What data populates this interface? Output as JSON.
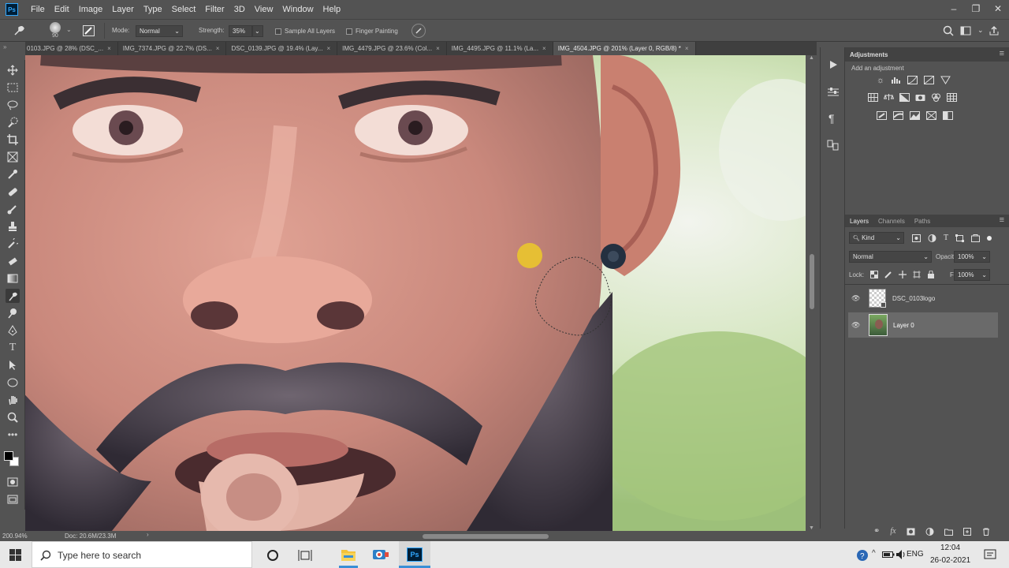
{
  "app": {
    "logo_text": "Ps"
  },
  "menu": [
    "File",
    "Edit",
    "Image",
    "Layer",
    "Type",
    "Select",
    "Filter",
    "3D",
    "View",
    "Window",
    "Help"
  ],
  "options": {
    "brush_size": "90",
    "mode_label": "Mode:",
    "mode_value": "Normal",
    "strength_label": "Strength:",
    "strength_value": "35%",
    "sample_all_layers": "Sample All Layers",
    "finger_painting": "Finger Painting"
  },
  "tabs": [
    {
      "label": "0103.JPG @ 28% (DSC_...",
      "active": false
    },
    {
      "label": "IMG_7374.JPG @ 22.7% (DS...",
      "active": false
    },
    {
      "label": "DSC_0139.JPG @ 19.4% (Lay...",
      "active": false
    },
    {
      "label": "IMG_4479.JPG @ 23.6% (Col...",
      "active": false
    },
    {
      "label": "IMG_4495.JPG @ 11.1% (La...",
      "active": false
    },
    {
      "label": "IMG_4504.JPG @ 201% (Layer 0, RGB/8) *",
      "active": true
    }
  ],
  "status": {
    "zoom": "200.94%",
    "doc": "Doc: 20.6M/23.3M"
  },
  "adjustments": {
    "title": "Adjustments",
    "subtitle": "Add an adjustment"
  },
  "layers_panel": {
    "tabs": [
      "Layers",
      "Channels",
      "Paths"
    ],
    "filter_kind": "Kind",
    "blend_mode": "Normal",
    "opacity_label": "Opacity:",
    "opacity_value": "100%",
    "lock_label": "Lock:",
    "fill_label": "Fill:",
    "fill_value": "100%",
    "layers": [
      {
        "name": "DSC_0103logo",
        "selected": false
      },
      {
        "name": "Layer 0",
        "selected": true
      }
    ]
  },
  "taskbar": {
    "search_placeholder": "Type here to search",
    "language": "ENG",
    "time": "12:04",
    "date": "26-02-2021"
  },
  "colors": {
    "ui_bg": "#535353",
    "accent": "#31a8ff",
    "cursor_yellow": "#e8c230"
  }
}
